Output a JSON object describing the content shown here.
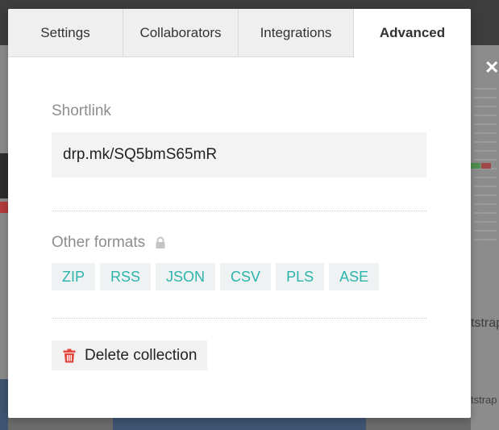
{
  "background": {
    "snippet_1": "tstrap",
    "snippet_2": "tstrap"
  },
  "close_icon": "close-icon",
  "modal": {
    "tabs": [
      {
        "label": "Settings",
        "active": false
      },
      {
        "label": "Collaborators",
        "active": false
      },
      {
        "label": "Integrations",
        "active": false
      },
      {
        "label": "Advanced",
        "active": true
      }
    ],
    "shortlink": {
      "label": "Shortlink",
      "value": "drp.mk/SQ5bmS65mR"
    },
    "other_formats": {
      "label": "Other formats",
      "icon": "lock-icon",
      "formats": [
        "ZIP",
        "RSS",
        "JSON",
        "CSV",
        "PLS",
        "ASE"
      ]
    },
    "delete": {
      "label": "Delete collection",
      "icon": "trash-icon"
    }
  },
  "colors": {
    "accent_teal": "#2bb5ad",
    "danger_red": "#e2453b",
    "label_gray": "#8d8d8d"
  }
}
